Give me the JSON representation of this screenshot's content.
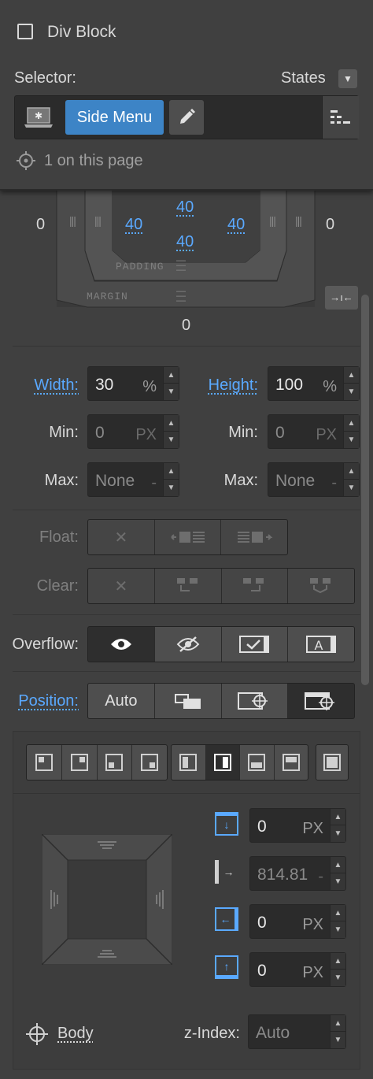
{
  "header": {
    "element_type": "Div Block",
    "selector_label": "Selector:",
    "states_label": "States",
    "class_name": "Side Menu",
    "count_text": "1 on this page"
  },
  "box_model": {
    "margin_left": "0",
    "margin_right": "0",
    "margin_bottom": "0",
    "padding_top": "40",
    "padding_bottom": "40",
    "padding_left": "40",
    "padding_right": "40",
    "padding_label": "PADDING",
    "margin_label": "MARGIN"
  },
  "size": {
    "width_label": "Width:",
    "width_value": "30",
    "width_unit": "%",
    "height_label": "Height:",
    "height_value": "100",
    "height_unit": "%",
    "min_label": "Min:",
    "min_w": "0",
    "min_w_unit": "PX",
    "min_h": "0",
    "min_h_unit": "PX",
    "max_label": "Max:",
    "max_w": "None",
    "max_w_unit": "-",
    "max_h": "None",
    "max_h_unit": "-"
  },
  "float": {
    "label": "Float:",
    "options": [
      "none-icon",
      "float-left-icon",
      "float-right-icon"
    ]
  },
  "clear": {
    "label": "Clear:",
    "options": [
      "none-icon",
      "clear-left-icon",
      "clear-right-icon",
      "clear-both-icon"
    ]
  },
  "overflow": {
    "label": "Overflow:",
    "options": [
      "visible-icon",
      "hidden-icon",
      "scroll-icon",
      "auto-icon"
    ],
    "selected": "visible-icon"
  },
  "position": {
    "label": "Position:",
    "options": [
      "Auto",
      "relative-icon",
      "absolute-icon",
      "fixed-icon"
    ],
    "selected": "fixed-icon",
    "offset_top": "0",
    "offset_top_unit": "PX",
    "offset_right": "814.81",
    "offset_right_unit": "-",
    "offset_left": "0",
    "offset_left_unit": "PX",
    "offset_bottom": "0",
    "offset_bottom_unit": "PX",
    "relative_to": "Body",
    "zindex_label": "z-Index:",
    "zindex_value": "Auto"
  },
  "colors": {
    "accent_blue": "#3d84c6",
    "link_blue": "#5aa9ff",
    "panel_bg": "#404040",
    "field_bg": "#2b2b2b"
  }
}
